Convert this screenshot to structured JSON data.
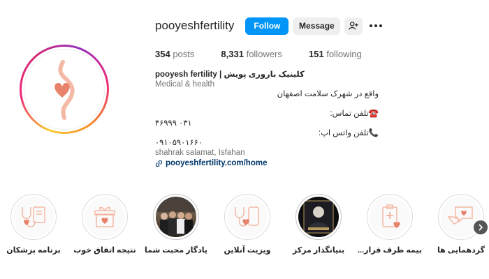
{
  "profile": {
    "username": "pooyeshfertility",
    "follow_label": "Follow",
    "message_label": "Message",
    "suggest_icon": "person-add-icon",
    "more_icon": "more-options-icon"
  },
  "stats": {
    "posts_count": "354",
    "posts_label": "posts",
    "followers_count": "8,331",
    "followers_label": "followers",
    "following_count": "151",
    "following_label": "following"
  },
  "bio": {
    "name": "pooyesh fertility | کلینیک باروری پویش",
    "category": "Medical & health",
    "location_fa": "واقع در شهرک سلامت اصفهان",
    "phone_label": "☎️تلفن تماس:",
    "phone_number": "۴۶۹۹۹ ۰۳۱",
    "whatsapp_label": "📞تلفن واتس اپ:",
    "whatsapp_number": "۰۹۱۰۵۹۰۱۶۶۰",
    "address": "shahrak salamat, Isfahan",
    "link": "pooyeshfertility.com/home"
  },
  "highlights": [
    {
      "label": "برنامه پزشکان",
      "icon": "stethoscope-clipboard-icon"
    },
    {
      "label": "نتیجه اتفاق خوب",
      "icon": "gift-heart-icon"
    },
    {
      "label": "یادگار محبت شما",
      "icon": "group-photo"
    },
    {
      "label": "ویزیت آنلاین",
      "icon": "stethoscope-phone-icon"
    },
    {
      "label": "بنیانگذار مرکز",
      "icon": "founder-photo"
    },
    {
      "label": "بیمه طرف قرار...",
      "icon": "insurance-clipboard-icon"
    },
    {
      "label": "گردهمایی ها",
      "icon": "chat-heart-icon"
    }
  ],
  "colors": {
    "accent": "#0095f6",
    "brand_peach": "#f4b9a5",
    "brand_coral": "#e8826a"
  }
}
